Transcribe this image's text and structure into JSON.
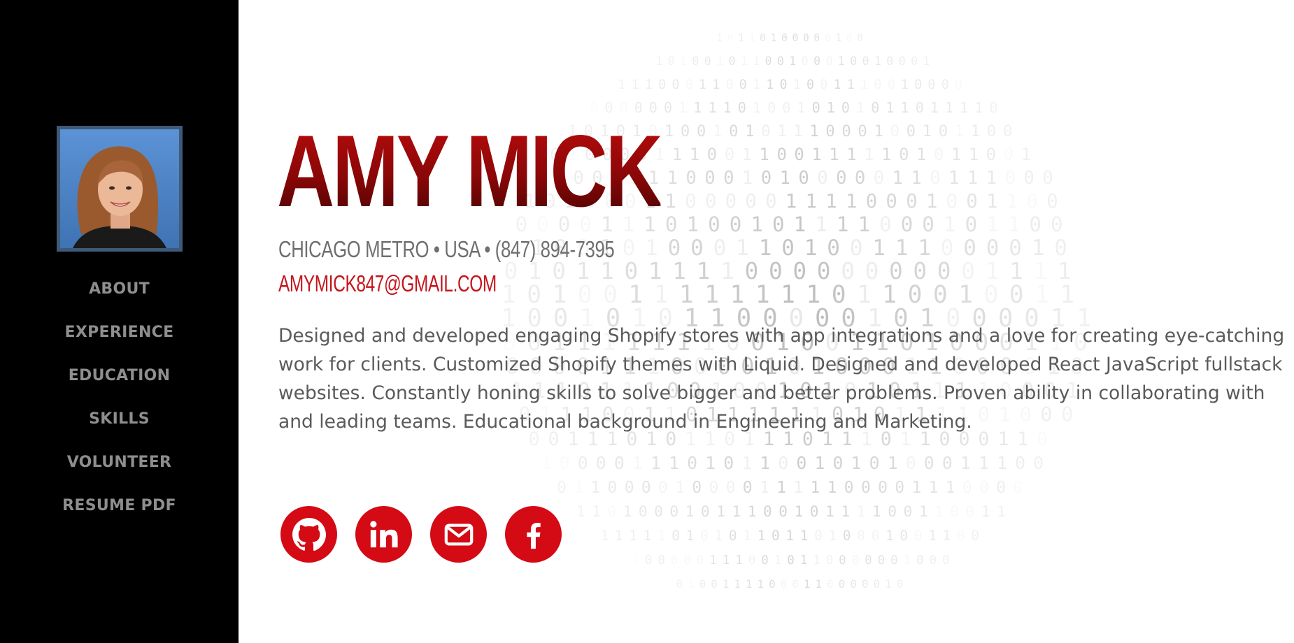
{
  "profile": {
    "name": "AMY MICK",
    "location": "CHICAGO METRO • USA • (847) 894-7395",
    "email": "AMYMICK847@GMAIL.COM",
    "bio": "Designed and developed engaging Shopify stores with app integrations and a love for creating eye-catching work for clients. Customized Shopify themes with Liquid. Designed and developed React JavaScript fullstack websites. Constantly honing skills to solve bigger and better problems. Proven ability in collaborating with and leading teams. Educational background in Engineering and Marketing."
  },
  "nav": {
    "items": [
      {
        "label": "ABOUT"
      },
      {
        "label": "EXPERIENCE"
      },
      {
        "label": "EDUCATION"
      },
      {
        "label": "SKILLS"
      },
      {
        "label": "VOLUNTEER"
      },
      {
        "label": "RESUME PDF"
      }
    ]
  },
  "social": {
    "icons": [
      "github-icon",
      "linkedin-icon",
      "envelope-icon",
      "facebook-icon"
    ]
  },
  "colors": {
    "sidebar": "#000000",
    "accent": "#d40a14",
    "name": "#9b0a0a",
    "nav_text": "#8e8e8e",
    "body_text": "#5a5a5a"
  }
}
